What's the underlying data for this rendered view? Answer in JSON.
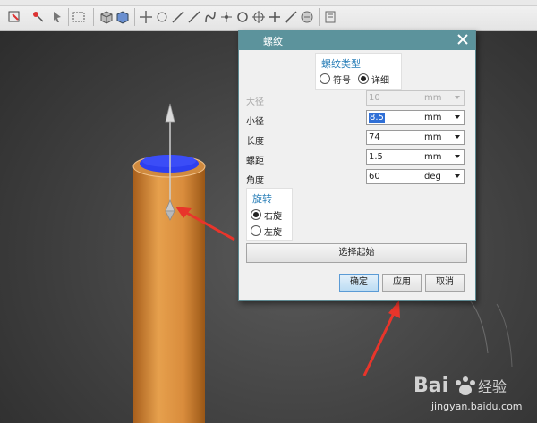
{
  "dialog": {
    "title": "螺纹",
    "thread_type": {
      "title": "螺纹类型",
      "options": [
        "符号",
        "详细"
      ],
      "selected": "详细"
    },
    "fields": [
      {
        "label": "大径",
        "value": "10",
        "unit": "mm",
        "disabled": true
      },
      {
        "label": "小径",
        "value": "8.5",
        "unit": "mm",
        "disabled": false,
        "selected_text": true
      },
      {
        "label": "长度",
        "value": "74",
        "unit": "mm",
        "disabled": false
      },
      {
        "label": "螺距",
        "value": "1.5",
        "unit": "mm",
        "disabled": false
      },
      {
        "label": "角度",
        "value": "60",
        "unit": "deg",
        "disabled": false
      }
    ],
    "rotation": {
      "title": "旋转",
      "options": [
        "右旋",
        "左旋"
      ],
      "selected": "右旋"
    },
    "select_start_label": "选择起始",
    "buttons": {
      "ok": "确定",
      "apply": "应用",
      "cancel": "取消"
    }
  },
  "watermark": {
    "text": "jingyan.baidu.com"
  },
  "colors": {
    "titlebar": "#5c939c",
    "cylinder": "#d98c3c",
    "cap": "#2d3ff0",
    "annotation_arrow": "#e8352b",
    "group_title": "#2a7fb8"
  }
}
